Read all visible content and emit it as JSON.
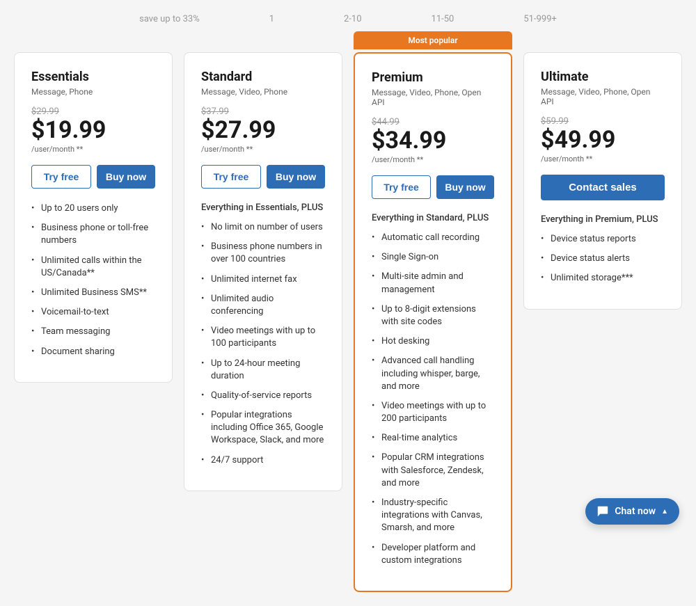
{
  "topnav": {
    "labels": [
      "save up to 33%",
      "1",
      "2-10",
      "11-50",
      "51-999+"
    ]
  },
  "plans": [
    {
      "id": "essentials",
      "name": "Essentials",
      "subtitle": "Message, Phone",
      "original_price": "$29.99",
      "current_price": "$19.99",
      "price_detail": "/user/month **",
      "try_label": "Try free",
      "buy_label": "Buy now",
      "plus_label": "",
      "features": [
        "Up to 20 users only",
        "Business phone or toll-free numbers",
        "Unlimited calls within the US/Canada**",
        "Unlimited Business SMS**",
        "Voicemail-to-text",
        "Team messaging",
        "Document sharing"
      ]
    },
    {
      "id": "standard",
      "name": "Standard",
      "subtitle": "Message, Video, Phone",
      "original_price": "$37.99",
      "current_price": "$27.99",
      "price_detail": "/user/month **",
      "try_label": "Try free",
      "buy_label": "Buy now",
      "plus_label": "Everything in Essentials, PLUS",
      "features": [
        "No limit on number of users",
        "Business phone numbers in over 100 countries",
        "Unlimited internet fax",
        "Unlimited audio conferencing",
        "Video meetings with up to 100 participants",
        "Up to 24-hour meeting duration",
        "Quality-of-service reports",
        "Popular integrations including Office 365, Google Workspace, Slack, and more",
        "24/7 support"
      ]
    },
    {
      "id": "premium",
      "name": "Premium",
      "subtitle": "Message, Video, Phone, Open API",
      "original_price": "$44.99",
      "current_price": "$34.99",
      "price_detail": "/user/month **",
      "try_label": "Try free",
      "buy_label": "Buy now",
      "popular_badge": "Most popular",
      "plus_label": "Everything in Standard, PLUS",
      "features": [
        "Automatic call recording",
        "Single Sign-on",
        "Multi-site admin and management",
        "Up to 8-digit extensions with site codes",
        "Hot desking",
        "Advanced call handling including whisper, barge, and more",
        "Video meetings with up to 200 participants",
        "Real-time analytics",
        "Popular CRM integrations with Salesforce, Zendesk, and more",
        "Industry-specific integrations with Canvas, Smarsh, and more",
        "Developer platform and custom integrations"
      ]
    },
    {
      "id": "ultimate",
      "name": "Ultimate",
      "subtitle": "Message, Video, Phone, Open API",
      "original_price": "$59.99",
      "current_price": "$49.99",
      "price_detail": "/user/month **",
      "contact_label": "Contact sales",
      "plus_label": "Everything in Premium, PLUS",
      "features": [
        "Device status reports",
        "Device status alerts",
        "Unlimited storage***"
      ]
    }
  ],
  "chat_widget": {
    "label": "Chat now",
    "chevron": "▲"
  }
}
